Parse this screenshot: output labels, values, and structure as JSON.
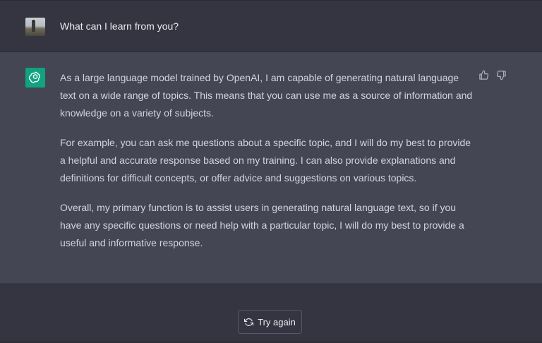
{
  "conversation": {
    "user_message": {
      "avatar": "user-photo-avatar",
      "text": "What can I learn from you?"
    },
    "assistant_message": {
      "avatar": "openai-logo-icon",
      "paragraphs": [
        "As a large language model trained by OpenAI, I am capable of generating natural language text on a wide range of topics. This means that you can use me as a source of information and knowledge on a variety of subjects.",
        "For example, you can ask me questions about a specific topic, and I will do my best to provide a helpful and accurate response based on my training. I can also provide explanations and definitions for difficult concepts, or offer advice and suggestions on various topics.",
        "Overall, my primary function is to assist users in generating natural language text, so if you have any specific questions or need help with a particular topic, I will do my best to provide a useful and informative response."
      ],
      "feedback": {
        "thumbs_up_icon": "thumbs-up-icon",
        "thumbs_down_icon": "thumbs-down-icon"
      }
    }
  },
  "actions": {
    "try_again_label": "Try again",
    "try_again_icon": "refresh-icon"
  },
  "colors": {
    "background": "#343541",
    "assistant_background": "#444654",
    "brand": "#10a37f",
    "text": "#d1d5db"
  }
}
